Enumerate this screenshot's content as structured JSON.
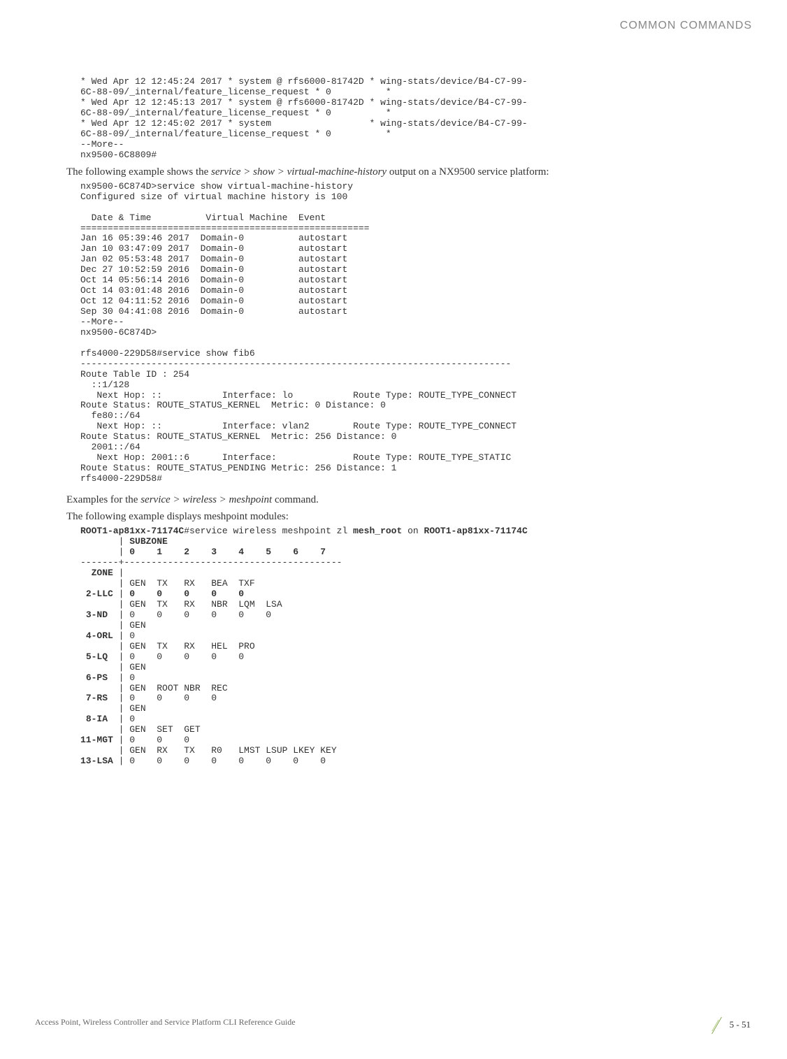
{
  "header": {
    "title": "COMMON COMMANDS"
  },
  "footer": {
    "text": "Access Point, Wireless Controller and Service Platform CLI Reference Guide",
    "page": "5 - 51"
  },
  "block1": "* Wed Apr 12 12:45:24 2017 * system @ rfs6000-81742D * wing-stats/device/B4-C7-99-\n6C-88-09/_internal/feature_license_request * 0          *\n* Wed Apr 12 12:45:13 2017 * system @ rfs6000-81742D * wing-stats/device/B4-C7-99-\n6C-88-09/_internal/feature_license_request * 0          *\n* Wed Apr 12 12:45:02 2017 * system                  * wing-stats/device/B4-C7-99-\n6C-88-09/_internal/feature_license_request * 0          *\n--More--\nnx9500-6C8809#",
  "para1_before": "The following example shows the ",
  "para1_em": "service > show > virtual-machine-history",
  "para1_after": " output on a NX9500 service platform:",
  "block2": "nx9500-6C874D>service show virtual-machine-history\nConfigured size of virtual machine history is 100\n\n  Date & Time          Virtual Machine  Event\n=====================================================\nJan 16 05:39:46 2017  Domain-0          autostart\nJan 10 03:47:09 2017  Domain-0          autostart\nJan 02 05:53:48 2017  Domain-0          autostart\nDec 27 10:52:59 2016  Domain-0          autostart\nOct 14 05:56:14 2016  Domain-0          autostart\nOct 14 03:01:48 2016  Domain-0          autostart\nOct 12 04:11:52 2016  Domain-0          autostart\nSep 30 04:41:08 2016  Domain-0          autostart\n--More--\nnx9500-6C874D>\n\nrfs4000-229D58#service show fib6\n-------------------------------------------------------------------------------\nRoute Table ID : 254\n  ::1/128\n   Next Hop: ::           Interface: lo           Route Type: ROUTE_TYPE_CONNECT  \nRoute Status: ROUTE_STATUS_KERNEL  Metric: 0 Distance: 0\n  fe80::/64\n   Next Hop: ::           Interface: vlan2        Route Type: ROUTE_TYPE_CONNECT  \nRoute Status: ROUTE_STATUS_KERNEL  Metric: 256 Distance: 0\n  2001::/64\n   Next Hop: 2001::6      Interface:              Route Type: ROUTE_TYPE_STATIC   \nRoute Status: ROUTE_STATUS_PENDING Metric: 256 Distance: 1\nrfs4000-229D58#",
  "para2_before": "Examples for the ",
  "para2_em": "service > wireless > meshpoint",
  "para2_after": " command.",
  "para3": "The following example displays meshpoint modules:",
  "block3": {
    "pre1": "ROOT1-ap81xx-71174C",
    "mid1": "#service wireless meshpoint zl ",
    "b1": "mesh_root",
    "mid2": " on ",
    "b2": "ROOT1-ap81xx-71174C",
    "line2a": "       | ",
    "line2b": "SUBZONE",
    "line3a": "       | ",
    "line3b": "0    1    2    3    4    5    6    7",
    "line4": "-------+----------------------------------------",
    "line5a": "  ",
    "line5b": "ZONE",
    "line5c": " |",
    "line6": "       | GEN  TX   RX   BEA  TXF",
    "line7a": " ",
    "line7b": "2-LLC",
    "line7c": " | ",
    "line7d": "0    0    0    0    0",
    "line8": "       | GEN  TX   RX   NBR  LQM  LSA",
    "line9a": " ",
    "line9b": "3-ND",
    "line9c": "  | 0    0    0    0    0    0",
    "line10": "       | GEN",
    "line11a": " ",
    "line11b": "4-ORL",
    "line11c": " | 0",
    "line12": "       | GEN  TX   RX   HEL  PRO",
    "line13a": " ",
    "line13b": "5-LQ",
    "line13c": "  | 0    0    0    0    0",
    "line14": "       | GEN",
    "line15a": " ",
    "line15b": "6-PS",
    "line15c": "  | 0",
    "line16": "       | GEN  ROOT NBR  REC",
    "line17a": " ",
    "line17b": "7-RS",
    "line17c": "  | 0    0    0    0",
    "line18": "       | GEN",
    "line19a": " ",
    "line19b": "8-IA",
    "line19c": "  | 0",
    "line20": "       | GEN  SET  GET",
    "line21a": "",
    "line21b": "11-MGT",
    "line21c": " | 0    0    0",
    "line22": "       | GEN  RX   TX   R0   LMST LSUP LKEY KEY",
    "line23a": "",
    "line23b": "13-LSA",
    "line23c": " | 0    0    0    0    0    0    0    0"
  }
}
